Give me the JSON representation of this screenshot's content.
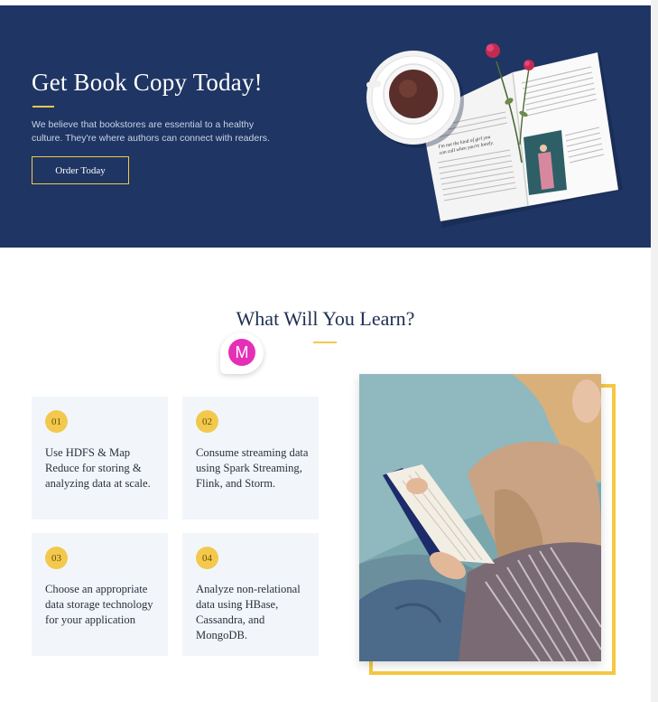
{
  "hero": {
    "title": "Get Book Copy Today!",
    "description": "We believe that bookstores are essential to a healthy culture. They're where authors can connect with readers.",
    "button_label": "Order Today",
    "book_quote": "I'm not the kind of girl you can call when you're lonely."
  },
  "learn": {
    "title": "What Will You Learn?",
    "avatar_letter": "M",
    "cards": [
      {
        "num": "01",
        "text": "Use HDFS & Map Reduce for storing & analyzing data at scale."
      },
      {
        "num": "02",
        "text": "Consume streaming data using Spark Streaming, Flink, and Storm."
      },
      {
        "num": "03",
        "text": "Choose an appropriate data storage technology for your application"
      },
      {
        "num": "04",
        "text": "Analyze non-relational data using HBase, Cassandra, and MongoDB."
      }
    ]
  },
  "colors": {
    "navy": "#1f3563",
    "gold": "#f2c94c",
    "card_bg": "#f2f6fb",
    "avatar": "#e62fb7"
  }
}
